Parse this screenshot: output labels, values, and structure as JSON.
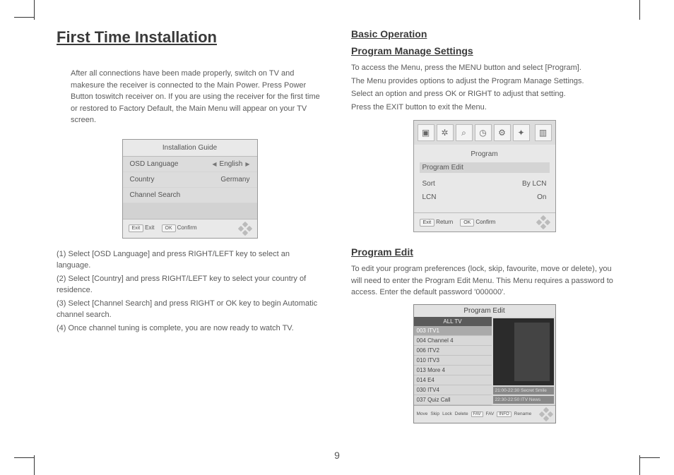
{
  "page_number": "9",
  "heading_main": "First Time Installation",
  "intro_text": "After all connections have been made properly, switch on TV and makesure the receiver is connected to the Main Power. Press Power Button toswitch receiver on. If you are using the receiver for the first time or restored to Factory Default, the Main Menu will appear on your TV screen.",
  "install_guide": {
    "title": "Installation Guide",
    "rows": [
      {
        "label": "OSD Language",
        "value": "English",
        "has_arrows": true
      },
      {
        "label": "Country",
        "value": "Germany",
        "has_arrows": false
      },
      {
        "label": "Channel Search",
        "value": "",
        "has_arrows": false
      }
    ],
    "footer": {
      "exit_key": "Exit",
      "exit_label": "Exit",
      "ok_key": "OK",
      "ok_label": "Confirm"
    }
  },
  "steps": [
    "(1) Select [OSD Language] and press RIGHT/LEFT key to select an language.",
    "(2) Select [Country] and press RIGHT/LEFT key to select your country of   residence.",
    "(3) Select [Channel Search] and press RIGHT or OK key to begin Automatic channel search.",
    "(4) Once channel tuning is complete, you are now ready to watch TV."
  ],
  "right": {
    "h_basic": "Basic Operation",
    "h_pms": "Program Manage Settings",
    "pms_lines": [
      "To access the Menu, press the MENU button and select [Program].",
      "The  Menu provides options to adjust the      Program Manage Settings.",
      "Select an option and press OK or RIGHT to adjust that setting.",
      "Press the EXIT button to exit the Menu."
    ],
    "program_menu": {
      "title": "Program",
      "first": "Program Edit",
      "rows": [
        {
          "label": "Sort",
          "value": "By LCN"
        },
        {
          "label": "LCN",
          "value": "On"
        }
      ],
      "footer": {
        "exit_key": "Exit",
        "exit_label": "Return",
        "ok_key": "OK",
        "ok_label": "Confirm"
      }
    },
    "h_pe": "Program Edit",
    "pe_para": "To edit your program preferences (lock, skip, favourite, move or delete), you will need to enter the Program Edit Menu. This Menu requires a password to access. Enter  the default password '000000'.",
    "pe_panel": {
      "title": "Program Edit",
      "tab": "ALL TV",
      "channels": [
        "003 ITV1",
        "004 Channel 4",
        "006 ITV2",
        "010 ITV3",
        "013 More 4",
        "014 E4",
        "030 ITV4",
        "037 Quiz Call"
      ],
      "epg": [
        "21:00-22:30  Secret Smile",
        "22:30-22:50  ITV News"
      ],
      "bar": [
        "Move",
        "Skip",
        "Lock",
        "Delete",
        "FAV",
        "FAV",
        "Rename"
      ],
      "bar_keys": [
        "",
        "",
        "",
        "",
        "FAV",
        "INFO",
        ""
      ]
    }
  }
}
